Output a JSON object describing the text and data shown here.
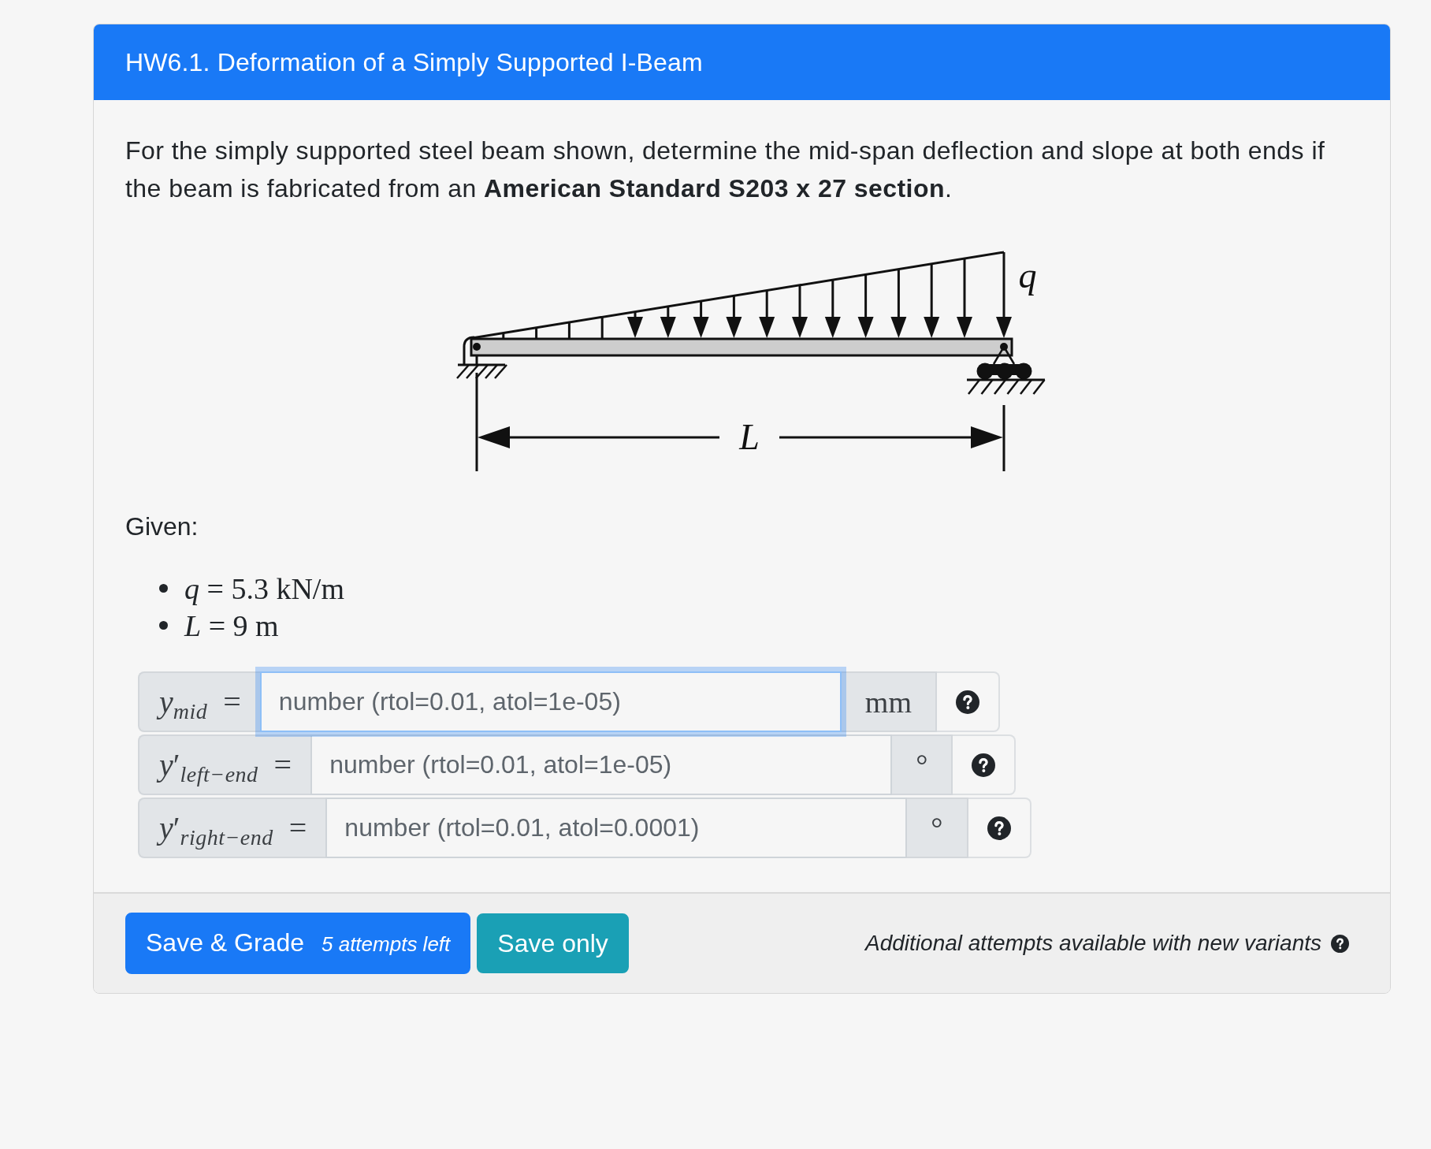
{
  "question": {
    "title": "HW6.1. Deformation of a Simply Supported I-Beam"
  },
  "statement": "For the simply supported steel beam shown, determine the mid-span deflection and slope at both ends if the beam is fabricated from an **American Standard S203 x 27 section**.",
  "figure": {
    "load_label": "q",
    "length_label": "L"
  },
  "given": {
    "heading": "Given:",
    "items": [
      "*q* = 5.3 kN/m",
      "*L* = 9 m"
    ]
  },
  "answers": [
    {
      "label": "*y*$_{mid}$ =",
      "placeholder": "number (rtol=0.01, atol=1e-05)",
      "unit": "mm",
      "focused": true
    },
    {
      "label": "*y*′$_{left−end}$ =",
      "placeholder": "number (rtol=0.01, atol=1e-05)",
      "unit": "°",
      "focused": false
    },
    {
      "label": "*y*′$_{right−end}$ =",
      "placeholder": "number (rtol=0.01, atol=0.0001)",
      "unit": "°",
      "focused": false
    }
  ],
  "footer": {
    "buttons": [
      {
        "kind": "grade",
        "label": "Save & Grade",
        "note": "5 attempts left"
      },
      {
        "kind": "save",
        "label": "Save only"
      }
    ],
    "message": "Additional attempts available with new variants"
  }
}
